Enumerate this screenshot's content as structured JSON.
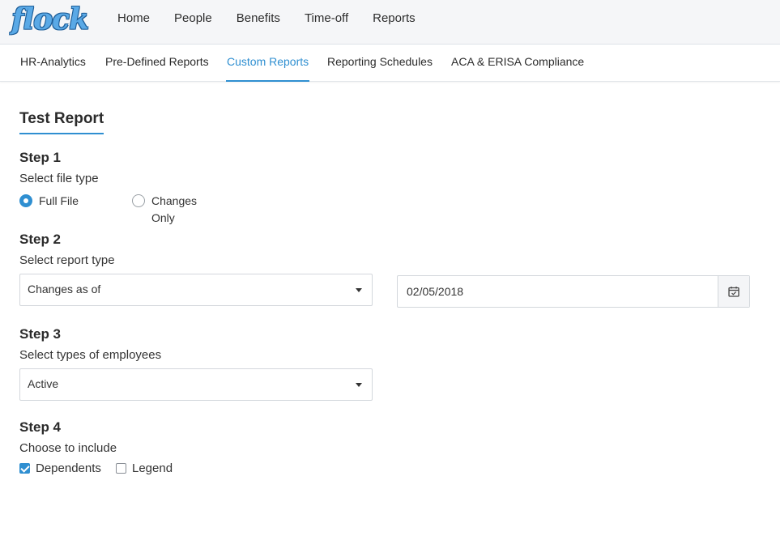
{
  "app": {
    "logo_text": "flock"
  },
  "nav": {
    "items": [
      "Home",
      "People",
      "Benefits",
      "Time-off",
      "Reports"
    ]
  },
  "subnav": {
    "items": [
      "HR-Analytics",
      "Pre-Defined Reports",
      "Custom Reports",
      "Reporting Schedules",
      "ACA & ERISA Compliance"
    ],
    "active": "Custom Reports"
  },
  "report": {
    "title": "Test Report"
  },
  "step1": {
    "heading": "Step 1",
    "label": "Select file type",
    "options": [
      {
        "label": "Full File",
        "checked": true
      },
      {
        "label_line1": "Changes",
        "label_line2": "Only",
        "checked": false
      }
    ]
  },
  "step2": {
    "heading": "Step 2",
    "label": "Select report type",
    "select_value": "Changes as of",
    "date_value": "02/05/2018"
  },
  "step3": {
    "heading": "Step 3",
    "label": "Select types of employees",
    "select_value": "Active"
  },
  "step4": {
    "heading": "Step 4",
    "label": "Choose to include",
    "options": [
      {
        "label": "Dependents",
        "checked": true
      },
      {
        "label": "Legend",
        "checked": false
      }
    ]
  },
  "colors": {
    "accent": "#2f8fd1",
    "logo": "#5aa9e6"
  },
  "icons": {
    "calendar": "calendar-icon",
    "dropdown": "chevron-down-icon"
  }
}
